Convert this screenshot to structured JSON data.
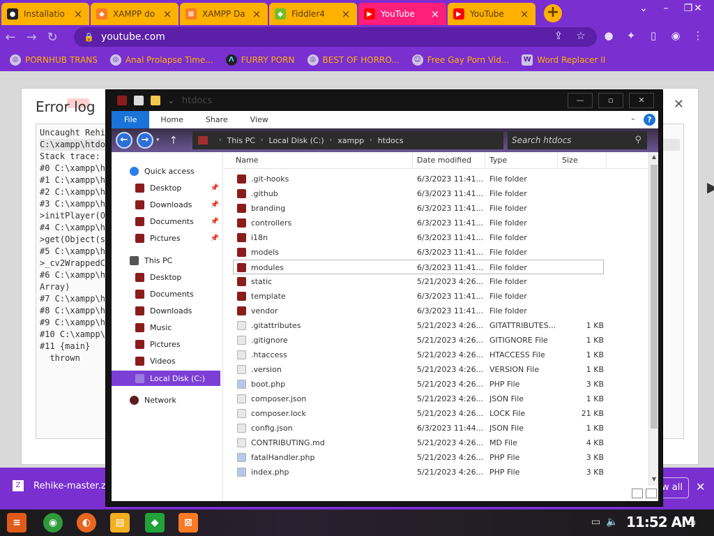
{
  "browser": {
    "tabs": [
      {
        "label": "Installatio",
        "icon": "github-icon",
        "icon_color": "#222222"
      },
      {
        "label": "XAMPP do",
        "icon": "xampp-icon",
        "icon_color": "#fb7a24"
      },
      {
        "label": "XAMPP Da",
        "icon": "xampp-icon",
        "icon_color": "#fb7a24"
      },
      {
        "label": "Fiddler4",
        "icon": "fiddler-icon",
        "icon_color": "#6cbf2a"
      },
      {
        "label": "YouTube",
        "icon": "youtube-icon",
        "icon_color": "#ff0000"
      },
      {
        "label": "YouTube",
        "icon": "youtube-icon",
        "icon_color": "#ff0000"
      }
    ],
    "url": "youtube.com",
    "bookmarks": [
      "PORNHUB TRANS",
      "Anal Prolapse Time...",
      "FURRY PORN",
      "BEST OF HORRO...",
      "Free Gay Porn Vid...",
      "Word Replacer II"
    ],
    "accent": "#7a2fd0",
    "tab_color": "#ffb100",
    "active_tab_color": "#ff1e7a"
  },
  "page": {
    "error_title": "Error log",
    "error_lines": [
      "Uncaught Rehi",
      "C:\\xampp\\htdo",
      "Stack trace:",
      "#0 C:\\xampp\\h",
      "#1 C:\\xampp\\h",
      "#2 C:\\xampp\\h",
      "#3 C:\\xampp\\h",
      ">initPlayer(O",
      "#4 C:\\xampp\\h",
      ">get(Object(s",
      "#5 C:\\xampp\\h",
      ">_cv2WrappedC",
      "#6 C:\\xampp\\h",
      "Array)",
      "#7 C:\\xampp\\h",
      "#8 C:\\xampp\\h",
      "#9 C:\\xampp\\h",
      "#10 C:\\xampp\\",
      "#11 {main}",
      "  thrown"
    ],
    "download_file": "Rehike-master.zi",
    "show_all": "w all"
  },
  "explorer": {
    "title": "htdocs",
    "ribbon_tabs": [
      "File",
      "Home",
      "Share",
      "View"
    ],
    "breadcrumbs": [
      "This PC",
      "Local Disk (C:)",
      "xampp",
      "htdocs"
    ],
    "search_placeholder": "Search htdocs",
    "nav": {
      "quick_access": "Quick access",
      "quick_items": [
        "Desktop",
        "Downloads",
        "Documents",
        "Pictures"
      ],
      "this_pc": "This PC",
      "pc_items": [
        "Desktop",
        "Documents",
        "Downloads",
        "Music",
        "Pictures",
        "Videos"
      ],
      "local_disk": "Local Disk (C:)",
      "network": "Network"
    },
    "columns": [
      "Name",
      "Date modified",
      "Type",
      "Size"
    ],
    "files": [
      {
        "name": ".git-hooks",
        "date": "6/3/2023 11:41...",
        "type": "File folder",
        "size": "",
        "kind": "folder"
      },
      {
        "name": ".github",
        "date": "6/3/2023 11:41...",
        "type": "File folder",
        "size": "",
        "kind": "folder"
      },
      {
        "name": "branding",
        "date": "6/3/2023 11:41...",
        "type": "File folder",
        "size": "",
        "kind": "folder"
      },
      {
        "name": "controllers",
        "date": "6/3/2023 11:41...",
        "type": "File folder",
        "size": "",
        "kind": "folder"
      },
      {
        "name": "i18n",
        "date": "6/3/2023 11:41...",
        "type": "File folder",
        "size": "",
        "kind": "folder"
      },
      {
        "name": "models",
        "date": "6/3/2023 11:41...",
        "type": "File folder",
        "size": "",
        "kind": "folder"
      },
      {
        "name": "modules",
        "date": "6/3/2023 11:41...",
        "type": "File folder",
        "size": "",
        "kind": "folder"
      },
      {
        "name": "static",
        "date": "5/21/2023 4:26...",
        "type": "File folder",
        "size": "",
        "kind": "folder"
      },
      {
        "name": "template",
        "date": "6/3/2023 11:41...",
        "type": "File folder",
        "size": "",
        "kind": "folder"
      },
      {
        "name": "vendor",
        "date": "6/3/2023 11:41...",
        "type": "File folder",
        "size": "",
        "kind": "folder"
      },
      {
        "name": ".gitattributes",
        "date": "5/21/2023 4:26...",
        "type": "GITATTRIBUTES...",
        "size": "1 KB",
        "kind": "file"
      },
      {
        "name": ".gitignore",
        "date": "5/21/2023 4:26...",
        "type": "GITIGNORE File",
        "size": "1 KB",
        "kind": "file"
      },
      {
        "name": ".htaccess",
        "date": "5/21/2023 4:26...",
        "type": "HTACCESS File",
        "size": "1 KB",
        "kind": "file"
      },
      {
        "name": ".version",
        "date": "5/21/2023 4:26...",
        "type": "VERSION File",
        "size": "1 KB",
        "kind": "file"
      },
      {
        "name": "boot.php",
        "date": "5/21/2023 4:26...",
        "type": "PHP File",
        "size": "3 KB",
        "kind": "php"
      },
      {
        "name": "composer.json",
        "date": "5/21/2023 4:26...",
        "type": "JSON File",
        "size": "1 KB",
        "kind": "file"
      },
      {
        "name": "composer.lock",
        "date": "5/21/2023 4:26...",
        "type": "LOCK File",
        "size": "21 KB",
        "kind": "file"
      },
      {
        "name": "config.json",
        "date": "6/3/2023 11:44...",
        "type": "JSON File",
        "size": "1 KB",
        "kind": "file"
      },
      {
        "name": "CONTRIBUTING.md",
        "date": "5/21/2023 4:26...",
        "type": "MD File",
        "size": "4 KB",
        "kind": "file"
      },
      {
        "name": "fatalHandler.php",
        "date": "5/21/2023 4:26...",
        "type": "PHP File",
        "size": "3 KB",
        "kind": "php"
      },
      {
        "name": "index.php",
        "date": "5/21/2023 4:26...",
        "type": "PHP File",
        "size": "3 KB",
        "kind": "php"
      }
    ],
    "selected_index": 6
  },
  "taskbar": {
    "clock": "11:52 AM",
    "apps": [
      {
        "icon": "start-icon",
        "color": "#e05a1a"
      },
      {
        "icon": "chrome-icon",
        "color": "#2f9a3b"
      },
      {
        "icon": "firefox-icon",
        "color": "#e8661f"
      },
      {
        "icon": "file-explorer-icon",
        "color": "#f2b01e"
      },
      {
        "icon": "gem-icon",
        "color": "#21a33a"
      },
      {
        "icon": "xampp-icon",
        "color": "#fb7a24"
      }
    ]
  }
}
